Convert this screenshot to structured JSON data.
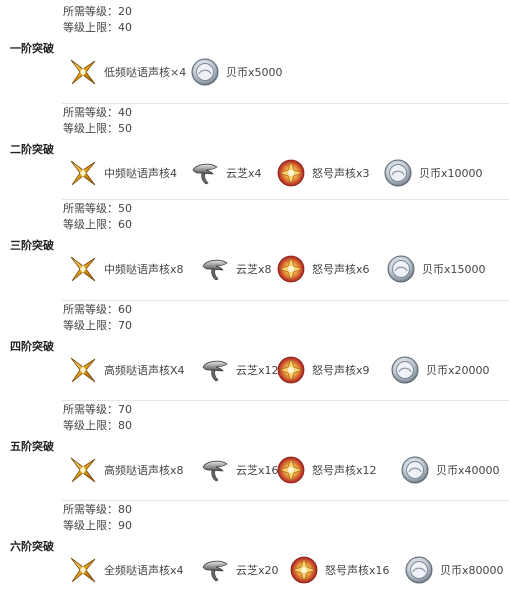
{
  "labels": {
    "required_level": "所需等级：",
    "level_cap": "等级上限："
  },
  "stages": [
    {
      "title": "一阶突破",
      "required_level": "20",
      "level_cap": "40",
      "materials": [
        {
          "icon": "whisper-core-icon",
          "label": "低频哒语声核×4"
        },
        {
          "icon": "shell-coin-icon",
          "label": "贝币x5000"
        }
      ]
    },
    {
      "title": "二阶突破",
      "required_level": "40",
      "level_cap": "50",
      "materials": [
        {
          "icon": "whisper-core-icon",
          "label": "中频哒语声核4"
        },
        {
          "icon": "cloud-mushroom-icon",
          "label": "云芝x4"
        },
        {
          "icon": "roar-core-icon",
          "label": "怒号声核x3"
        },
        {
          "icon": "shell-coin-icon",
          "label": "贝币x10000"
        }
      ]
    },
    {
      "title": "三阶突破",
      "required_level": "50",
      "level_cap": "60",
      "materials": [
        {
          "icon": "whisper-core-icon",
          "label": "中频哒语声核x8"
        },
        {
          "icon": "cloud-mushroom-icon",
          "label": "云芝x8"
        },
        {
          "icon": "roar-core-icon",
          "label": "怒号声核x6"
        },
        {
          "icon": "shell-coin-icon",
          "label": "贝币x15000"
        }
      ]
    },
    {
      "title": "四阶突破",
      "required_level": "60",
      "level_cap": "70",
      "materials": [
        {
          "icon": "whisper-core-icon",
          "label": "高频哒语声核X4"
        },
        {
          "icon": "cloud-mushroom-icon",
          "label": "云芝x12"
        },
        {
          "icon": "roar-core-icon",
          "label": "怒号声核x9"
        },
        {
          "icon": "shell-coin-icon",
          "label": "贝币x20000"
        }
      ]
    },
    {
      "title": "五阶突破",
      "required_level": "70",
      "level_cap": "80",
      "materials": [
        {
          "icon": "whisper-core-icon",
          "label": "高频哒语声核x8"
        },
        {
          "icon": "cloud-mushroom-icon",
          "label": "云芝x16"
        },
        {
          "icon": "roar-core-icon",
          "label": "怒号声核x12"
        },
        {
          "icon": "shell-coin-icon",
          "label": "贝币x40000"
        }
      ]
    },
    {
      "title": "六阶突破",
      "required_level": "80",
      "level_cap": "90",
      "materials": [
        {
          "icon": "whisper-core-icon",
          "label": "全频哒语声核x4"
        },
        {
          "icon": "cloud-mushroom-icon",
          "label": "云芝x20"
        },
        {
          "icon": "roar-core-icon",
          "label": "怒号声核x16"
        },
        {
          "icon": "shell-coin-icon",
          "label": "贝币x80000"
        }
      ]
    }
  ]
}
